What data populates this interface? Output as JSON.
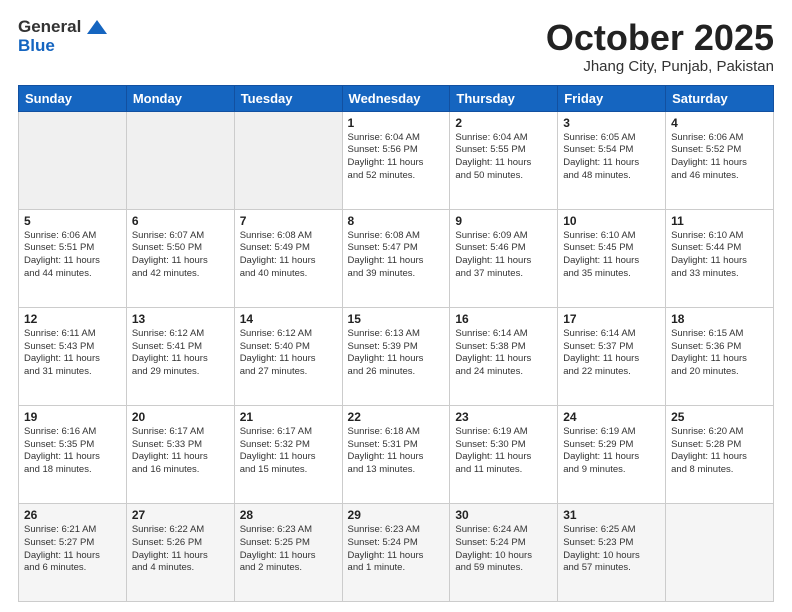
{
  "header": {
    "logo": {
      "general": "General",
      "blue": "Blue"
    },
    "title": "October 2025",
    "location": "Jhang City, Punjab, Pakistan"
  },
  "weekdays": [
    "Sunday",
    "Monday",
    "Tuesday",
    "Wednesday",
    "Thursday",
    "Friday",
    "Saturday"
  ],
  "weeks": [
    [
      {
        "day": "",
        "info": ""
      },
      {
        "day": "",
        "info": ""
      },
      {
        "day": "",
        "info": ""
      },
      {
        "day": "1",
        "info": "Sunrise: 6:04 AM\nSunset: 5:56 PM\nDaylight: 11 hours\nand 52 minutes."
      },
      {
        "day": "2",
        "info": "Sunrise: 6:04 AM\nSunset: 5:55 PM\nDaylight: 11 hours\nand 50 minutes."
      },
      {
        "day": "3",
        "info": "Sunrise: 6:05 AM\nSunset: 5:54 PM\nDaylight: 11 hours\nand 48 minutes."
      },
      {
        "day": "4",
        "info": "Sunrise: 6:06 AM\nSunset: 5:52 PM\nDaylight: 11 hours\nand 46 minutes."
      }
    ],
    [
      {
        "day": "5",
        "info": "Sunrise: 6:06 AM\nSunset: 5:51 PM\nDaylight: 11 hours\nand 44 minutes."
      },
      {
        "day": "6",
        "info": "Sunrise: 6:07 AM\nSunset: 5:50 PM\nDaylight: 11 hours\nand 42 minutes."
      },
      {
        "day": "7",
        "info": "Sunrise: 6:08 AM\nSunset: 5:49 PM\nDaylight: 11 hours\nand 40 minutes."
      },
      {
        "day": "8",
        "info": "Sunrise: 6:08 AM\nSunset: 5:47 PM\nDaylight: 11 hours\nand 39 minutes."
      },
      {
        "day": "9",
        "info": "Sunrise: 6:09 AM\nSunset: 5:46 PM\nDaylight: 11 hours\nand 37 minutes."
      },
      {
        "day": "10",
        "info": "Sunrise: 6:10 AM\nSunset: 5:45 PM\nDaylight: 11 hours\nand 35 minutes."
      },
      {
        "day": "11",
        "info": "Sunrise: 6:10 AM\nSunset: 5:44 PM\nDaylight: 11 hours\nand 33 minutes."
      }
    ],
    [
      {
        "day": "12",
        "info": "Sunrise: 6:11 AM\nSunset: 5:43 PM\nDaylight: 11 hours\nand 31 minutes."
      },
      {
        "day": "13",
        "info": "Sunrise: 6:12 AM\nSunset: 5:41 PM\nDaylight: 11 hours\nand 29 minutes."
      },
      {
        "day": "14",
        "info": "Sunrise: 6:12 AM\nSunset: 5:40 PM\nDaylight: 11 hours\nand 27 minutes."
      },
      {
        "day": "15",
        "info": "Sunrise: 6:13 AM\nSunset: 5:39 PM\nDaylight: 11 hours\nand 26 minutes."
      },
      {
        "day": "16",
        "info": "Sunrise: 6:14 AM\nSunset: 5:38 PM\nDaylight: 11 hours\nand 24 minutes."
      },
      {
        "day": "17",
        "info": "Sunrise: 6:14 AM\nSunset: 5:37 PM\nDaylight: 11 hours\nand 22 minutes."
      },
      {
        "day": "18",
        "info": "Sunrise: 6:15 AM\nSunset: 5:36 PM\nDaylight: 11 hours\nand 20 minutes."
      }
    ],
    [
      {
        "day": "19",
        "info": "Sunrise: 6:16 AM\nSunset: 5:35 PM\nDaylight: 11 hours\nand 18 minutes."
      },
      {
        "day": "20",
        "info": "Sunrise: 6:17 AM\nSunset: 5:33 PM\nDaylight: 11 hours\nand 16 minutes."
      },
      {
        "day": "21",
        "info": "Sunrise: 6:17 AM\nSunset: 5:32 PM\nDaylight: 11 hours\nand 15 minutes."
      },
      {
        "day": "22",
        "info": "Sunrise: 6:18 AM\nSunset: 5:31 PM\nDaylight: 11 hours\nand 13 minutes."
      },
      {
        "day": "23",
        "info": "Sunrise: 6:19 AM\nSunset: 5:30 PM\nDaylight: 11 hours\nand 11 minutes."
      },
      {
        "day": "24",
        "info": "Sunrise: 6:19 AM\nSunset: 5:29 PM\nDaylight: 11 hours\nand 9 minutes."
      },
      {
        "day": "25",
        "info": "Sunrise: 6:20 AM\nSunset: 5:28 PM\nDaylight: 11 hours\nand 8 minutes."
      }
    ],
    [
      {
        "day": "26",
        "info": "Sunrise: 6:21 AM\nSunset: 5:27 PM\nDaylight: 11 hours\nand 6 minutes."
      },
      {
        "day": "27",
        "info": "Sunrise: 6:22 AM\nSunset: 5:26 PM\nDaylight: 11 hours\nand 4 minutes."
      },
      {
        "day": "28",
        "info": "Sunrise: 6:23 AM\nSunset: 5:25 PM\nDaylight: 11 hours\nand 2 minutes."
      },
      {
        "day": "29",
        "info": "Sunrise: 6:23 AM\nSunset: 5:24 PM\nDaylight: 11 hours\nand 1 minute."
      },
      {
        "day": "30",
        "info": "Sunrise: 6:24 AM\nSunset: 5:24 PM\nDaylight: 10 hours\nand 59 minutes."
      },
      {
        "day": "31",
        "info": "Sunrise: 6:25 AM\nSunset: 5:23 PM\nDaylight: 10 hours\nand 57 minutes."
      },
      {
        "day": "",
        "info": ""
      }
    ]
  ]
}
